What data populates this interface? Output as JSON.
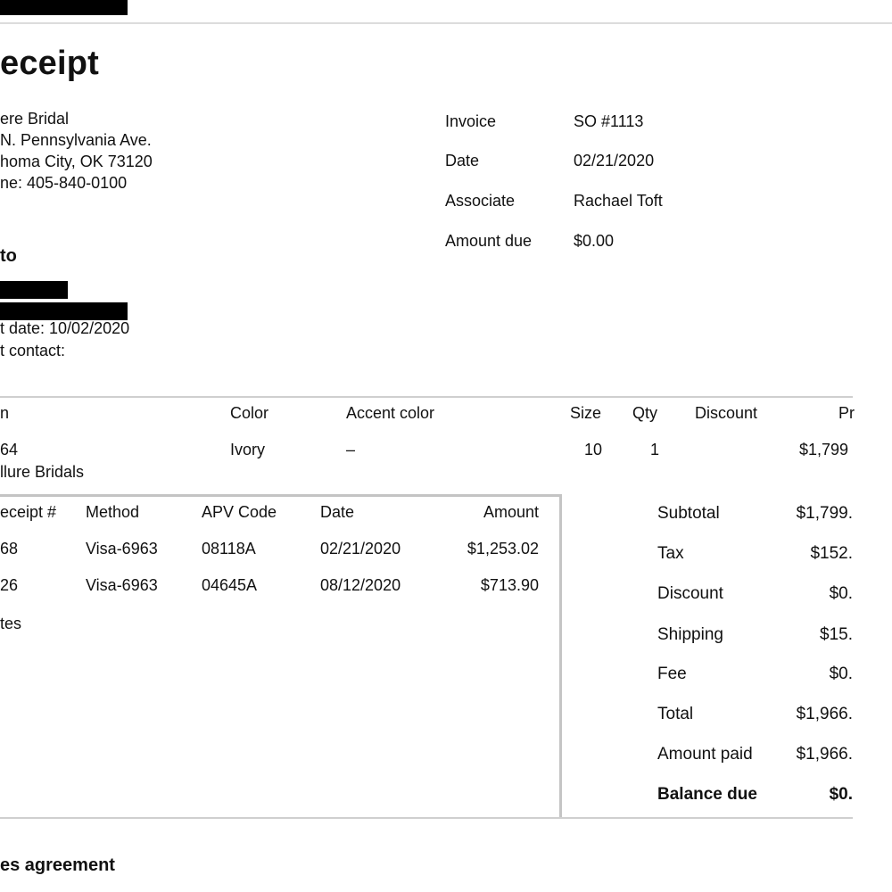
{
  "header": {
    "title": "eceipt"
  },
  "store": {
    "lines": [
      "ere Bridal",
      " N. Pennsylvania Ave.",
      "homa City, OK 73120",
      "ne: 405-840-0100"
    ]
  },
  "invoice_meta": {
    "rows": [
      {
        "label": "Invoice",
        "value": "SO #1113"
      },
      {
        "label": "Date",
        "value": "02/21/2020"
      },
      {
        "label": "Associate",
        "value": "Rachael Toft"
      },
      {
        "label": "Amount due",
        "value": "$0.00"
      }
    ]
  },
  "bill_to": {
    "heading": " to",
    "event_date": "t date: 10/02/2020",
    "event_contact": "t contact:"
  },
  "items_table": {
    "headers": {
      "item": "n",
      "color": "Color",
      "accent": "Accent color",
      "size": "Size",
      "qty": "Qty",
      "discount": "Discount",
      "price": "Pr"
    },
    "row": {
      "item_line1": "64",
      "item_line2": "llure Bridals",
      "color": "Ivory",
      "accent": "–",
      "size": "10",
      "qty": "1",
      "price": "$1,799"
    }
  },
  "payments": {
    "headers": {
      "receipt": "eceipt #",
      "method": "Method",
      "apv": "APV Code",
      "date": "Date",
      "amount": "Amount"
    },
    "rows": [
      {
        "receipt": "68",
        "method": "Visa-6963",
        "apv": "08118A",
        "date": "02/21/2020",
        "amount": "$1,253.02"
      },
      {
        "receipt": "26",
        "method": "Visa-6963",
        "apv": "04645A",
        "date": "08/12/2020",
        "amount": "$713.90"
      }
    ],
    "notes_label": "tes"
  },
  "totals": {
    "rows": [
      {
        "label": "Subtotal",
        "value": "$1,799."
      },
      {
        "label": "Tax",
        "value": "$152."
      },
      {
        "label": "Discount",
        "value": "$0."
      },
      {
        "label": "Shipping",
        "value": "$15."
      },
      {
        "label": "Fee",
        "value": "$0."
      },
      {
        "label": "Total",
        "value": "$1,966."
      },
      {
        "label": "Amount paid",
        "value": "$1,966."
      }
    ],
    "balance_label": "Balance due",
    "balance_value": "$0."
  },
  "agreement": {
    "heading": "es agreement"
  }
}
